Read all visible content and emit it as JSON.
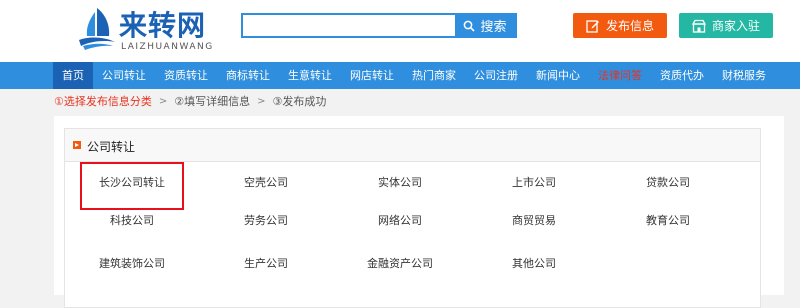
{
  "header": {
    "logo": {
      "title": "来转网",
      "subtitle": "LAIZHUANWANG"
    },
    "search": {
      "value": "",
      "placeholder": "",
      "button_label": "搜索"
    },
    "post_button": "发布信息",
    "join_button": "商家入驻"
  },
  "nav": {
    "items": [
      {
        "label": "首页",
        "state": "active"
      },
      {
        "label": "公司转让",
        "state": ""
      },
      {
        "label": "资质转让",
        "state": ""
      },
      {
        "label": "商标转让",
        "state": ""
      },
      {
        "label": "生意转让",
        "state": ""
      },
      {
        "label": "网店转让",
        "state": ""
      },
      {
        "label": "热门商家",
        "state": ""
      },
      {
        "label": "公司注册",
        "state": ""
      },
      {
        "label": "新闻中心",
        "state": ""
      },
      {
        "label": "法律问答",
        "state": "hot"
      },
      {
        "label": "资质代办",
        "state": ""
      },
      {
        "label": "财税服务",
        "state": ""
      }
    ]
  },
  "steps": [
    {
      "label": "①选择发布信息分类",
      "current": true
    },
    {
      "label": "②填写详细信息",
      "current": false
    },
    {
      "label": "③发布成功",
      "current": false
    }
  ],
  "category_panel": {
    "title": "公司转让",
    "items": [
      "长沙公司转让",
      "空壳公司",
      "实体公司",
      "上市公司",
      "贷款公司",
      "科技公司",
      "劳务公司",
      "网络公司",
      "商贸贸易",
      "教育公司",
      "建筑装饰公司",
      "生产公司",
      "金融资产公司",
      "其他公司"
    ],
    "selected": "长沙公司转让"
  },
  "colors": {
    "brand_blue": "#2f8fde",
    "active_nav": "#1b62b4",
    "post_orange": "#f25a0f",
    "join_teal": "#24b8a4",
    "highlight_red": "#e8101c"
  }
}
